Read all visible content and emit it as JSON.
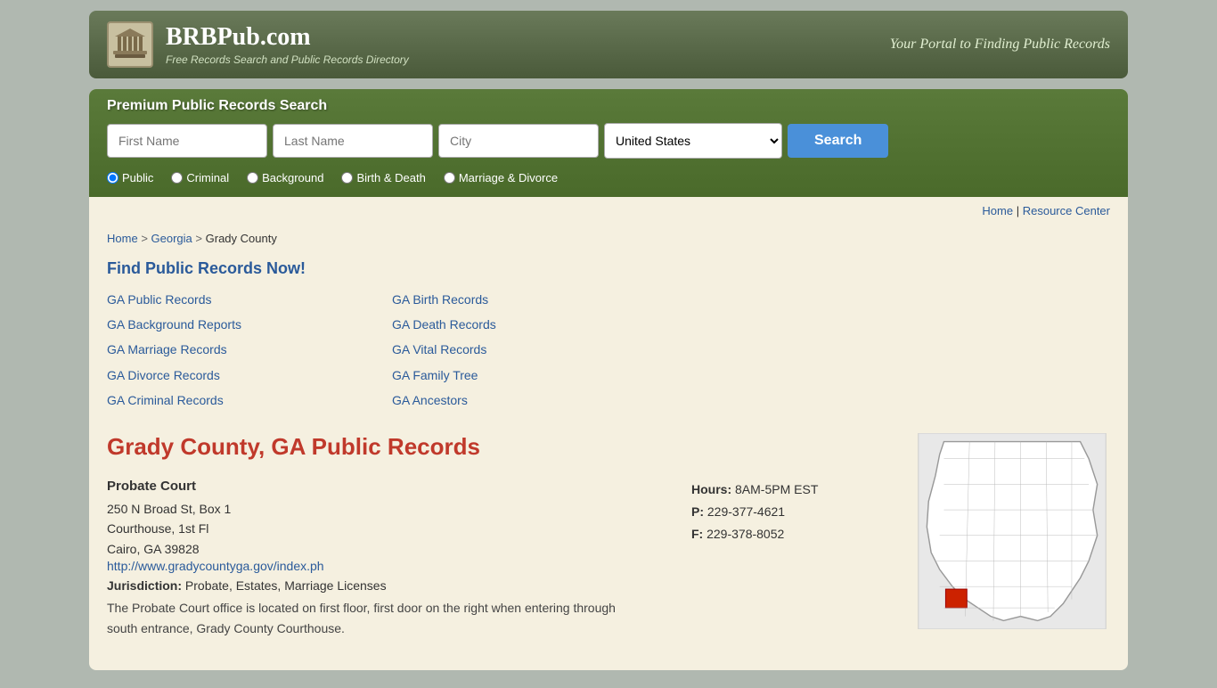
{
  "header": {
    "site_name": "BRBPub.com",
    "tagline": "Free Records Search and Public Records Directory",
    "slogan": "Your Portal to Finding Public Records"
  },
  "search": {
    "section_title": "Premium Public Records Search",
    "first_name_placeholder": "First Name",
    "last_name_placeholder": "Last Name",
    "city_placeholder": "City",
    "country_value": "United States",
    "button_label": "Search",
    "radio_options": [
      {
        "id": "radio-public",
        "label": "Public",
        "checked": true
      },
      {
        "id": "radio-criminal",
        "label": "Criminal",
        "checked": false
      },
      {
        "id": "radio-background",
        "label": "Background",
        "checked": false
      },
      {
        "id": "radio-birth-death",
        "label": "Birth & Death",
        "checked": false
      },
      {
        "id": "radio-marriage",
        "label": "Marriage & Divorce",
        "checked": false
      }
    ]
  },
  "nav": {
    "home": "Home",
    "separator": "|",
    "resource_center": "Resource Center"
  },
  "breadcrumb": {
    "home": "Home",
    "state": "Georgia",
    "county": "Grady County"
  },
  "records_section": {
    "heading": "Find Public Records Now!",
    "links_col1": [
      {
        "label": "GA Public Records",
        "href": "#"
      },
      {
        "label": "GA Background Reports",
        "href": "#"
      },
      {
        "label": "GA Marriage Records",
        "href": "#"
      },
      {
        "label": "GA Divorce Records",
        "href": "#"
      },
      {
        "label": "GA Criminal Records",
        "href": "#"
      }
    ],
    "links_col2": [
      {
        "label": "GA Birth Records",
        "href": "#"
      },
      {
        "label": "GA Death Records",
        "href": "#"
      },
      {
        "label": "GA Vital Records",
        "href": "#"
      },
      {
        "label": "GA Family Tree",
        "href": "#"
      },
      {
        "label": "GA Ancestors",
        "href": "#"
      }
    ]
  },
  "county": {
    "heading": "Grady County, GA Public Records",
    "probate_court": {
      "name": "Probate Court",
      "address_line1": "250 N Broad St, Box 1",
      "address_line2": "Courthouse, 1st Fl",
      "address_line3": "Cairo, GA 39828",
      "website": "http://www.gradycountyga.gov/index.ph",
      "hours_label": "Hours:",
      "hours_value": "8AM-5PM EST",
      "phone_label": "P:",
      "phone_value": "229-377-4621",
      "fax_label": "F:",
      "fax_value": "229-378-8052",
      "jurisdiction_label": "Jurisdiction:",
      "jurisdiction_value": "Probate, Estates, Marriage Licenses",
      "description": "The Probate Court office is located on first floor, first door on the right when entering through south entrance, Grady County Courthouse."
    }
  }
}
